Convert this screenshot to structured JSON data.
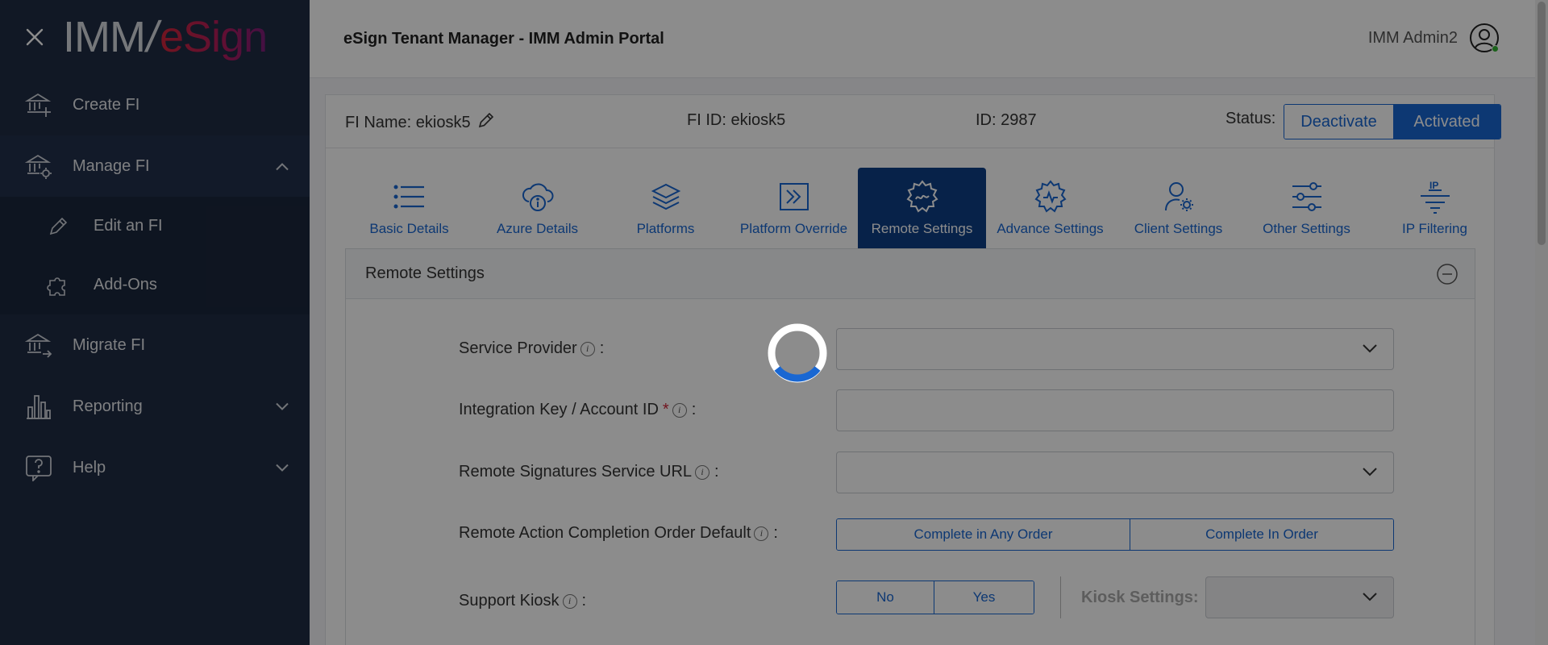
{
  "logo": {
    "part1": "IMM",
    "part2": "eSign"
  },
  "sidebar": {
    "items": [
      {
        "label": "Create FI",
        "icon": "bank-plus-icon"
      },
      {
        "label": "Manage FI",
        "icon": "bank-gear-icon",
        "expanded": true,
        "children": [
          {
            "label": "Edit an FI",
            "icon": "pencil-icon"
          },
          {
            "label": "Add-Ons",
            "icon": "puzzle-icon"
          }
        ]
      },
      {
        "label": "Migrate FI",
        "icon": "bank-arrow-icon"
      },
      {
        "label": "Reporting",
        "icon": "bar-chart-icon"
      },
      {
        "label": "Help",
        "icon": "help-icon"
      }
    ]
  },
  "header": {
    "title": "eSign Tenant Manager - IMM Admin Portal",
    "user": "IMM Admin2"
  },
  "fi": {
    "name_label": "FI Name: ekiosk5",
    "id_label": "FI ID: ekiosk5",
    "num_id_label": "ID: 2987",
    "status_label": "Status:",
    "deactivate": "Deactivate",
    "activated": "Activated"
  },
  "tabs": [
    {
      "label": "Basic Details",
      "icon": "list-icon"
    },
    {
      "label": "Azure Details",
      "icon": "cloud-info-icon"
    },
    {
      "label": "Platforms",
      "icon": "layers-icon"
    },
    {
      "label": "Platform Override",
      "icon": "arrow-box-icon"
    },
    {
      "label": "Remote Settings",
      "icon": "gear-signature-icon",
      "active": true
    },
    {
      "label": "Advance Settings",
      "icon": "gear-wave-icon"
    },
    {
      "label": "Client Settings",
      "icon": "user-gear-icon"
    },
    {
      "label": "Other Settings",
      "icon": "sliders-icon"
    },
    {
      "label": "IP Filtering",
      "icon": "ip-filter-icon"
    }
  ],
  "section": {
    "title": "Remote Settings",
    "service_provider": "Service Provider",
    "integration_key": "Integration Key / Account ID",
    "remote_url": "Remote Signatures Service URL",
    "completion_order": "Remote Action Completion Order Default",
    "any_order": "Complete in Any Order",
    "in_order": "Complete In Order",
    "support_kiosk": "Support Kiosk",
    "no": "No",
    "yes": "Yes",
    "kiosk_settings": "Kiosk Settings:",
    "colon": ":"
  },
  "colors": {
    "sidebar": "#1f2c44",
    "accent": "#1967d2",
    "active_tab": "#0e3f86",
    "brand_red": "#d0263a"
  }
}
